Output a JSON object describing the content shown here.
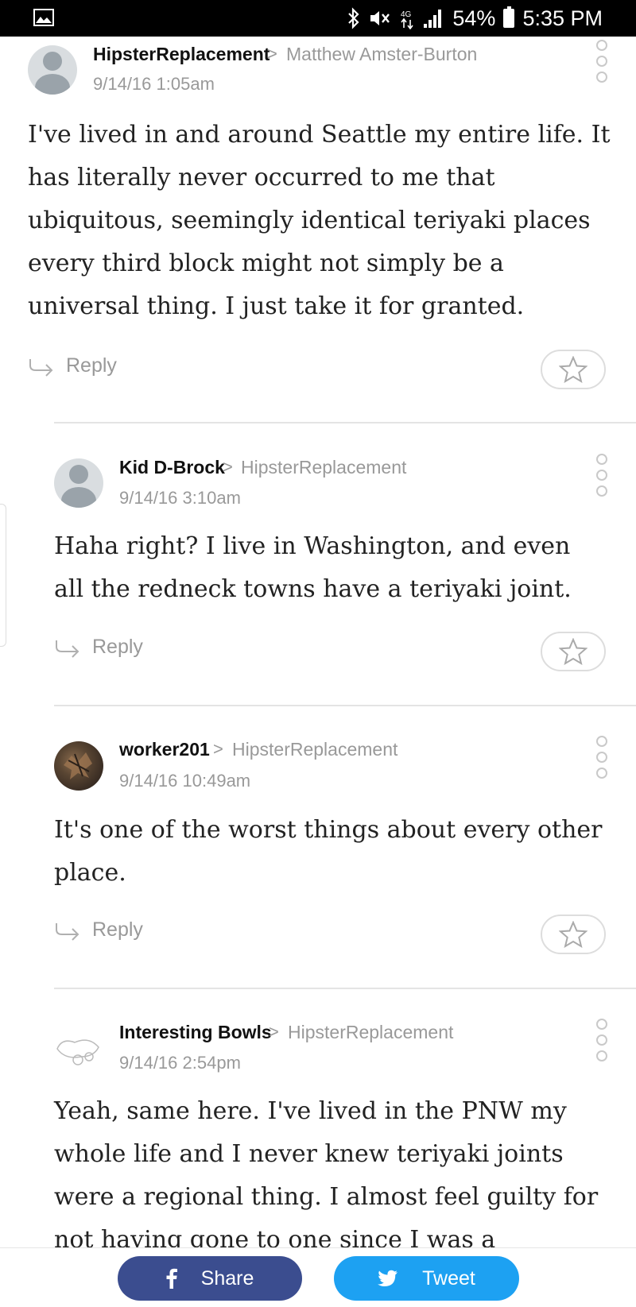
{
  "status_bar": {
    "battery": "54%",
    "time": "5:35 PM",
    "icons": [
      "image-icon",
      "bluetooth-icon",
      "mute-icon",
      "data-icon",
      "signal-icon",
      "battery-icon"
    ]
  },
  "comments": [
    {
      "author": "HipsterReplacement",
      "parent": "Matthew Amster-Burton",
      "date": "9/14/16 1:05am",
      "body": "I've lived in and around Seattle my entire life. It has literally never occurred to me that ubiquitous, seemingly identical teriyaki places every third block might not simply be a universal thing. I just take it for granted.",
      "reply_label": "Reply"
    },
    {
      "author": "Kid D-Brock",
      "parent": "HipsterReplacement",
      "date": "9/14/16 3:10am",
      "body": "Haha right? I live in Washington, and even all the redneck towns have a teriyaki joint.",
      "reply_label": "Reply"
    },
    {
      "author": "worker201",
      "parent": "HipsterReplacement",
      "date": "9/14/16 10:49am",
      "body": "It's one of the worst things about every other place.",
      "reply_label": "Reply"
    },
    {
      "author": "Interesting Bowls",
      "parent": "HipsterReplacement",
      "date": "9/14/16 2:54pm",
      "body": "Yeah, same here. I've lived in the PNW my whole life and I never knew teriyaki joints were a regional thing. I almost feel guilty for not having gone to one since I was a teenager. But"
    }
  ],
  "footer": {
    "share_label": "Share",
    "tweet_label": "Tweet"
  },
  "colors": {
    "share": "#3b4d8f",
    "tweet": "#1da1f2",
    "muted": "#999999"
  }
}
